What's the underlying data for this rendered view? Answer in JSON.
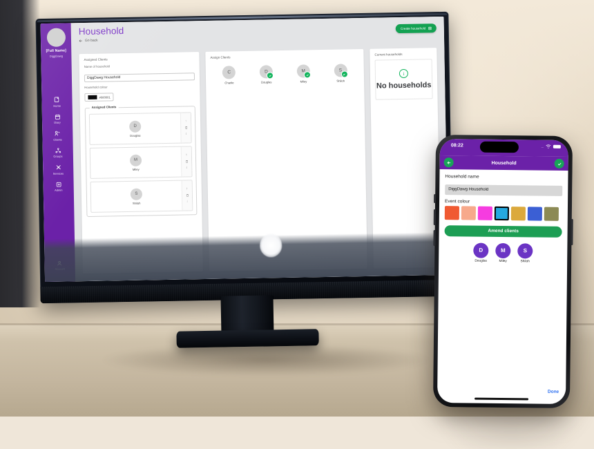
{
  "desktop": {
    "sidebar": {
      "full_name": "[Full Name]",
      "org_name": "DiggDawg",
      "items": [
        {
          "label": "Home",
          "icon": "home-icon"
        },
        {
          "label": "Diary",
          "icon": "calendar-icon"
        },
        {
          "label": "Clients",
          "icon": "clients-icon"
        },
        {
          "label": "Groups",
          "icon": "groups-icon"
        },
        {
          "label": "Services",
          "icon": "services-icon"
        },
        {
          "label": "Admin",
          "icon": "admin-icon"
        }
      ],
      "account": {
        "label": "Account",
        "icon": "account-icon"
      }
    },
    "header": {
      "title": "Household",
      "go_back": "Go back",
      "create_button": "Create household"
    },
    "panel_assigned": {
      "heading": "Assigned Clients",
      "name_label": "Name of household",
      "name_value": "DiggDawg Household",
      "colour_label": "Household colour",
      "colour_hex": "#000001",
      "fieldset_legend": "Assigned Clients",
      "clients": [
        {
          "initial": "D",
          "name": "Douglas"
        },
        {
          "initial": "M",
          "name": "Miley"
        },
        {
          "initial": "S",
          "name": "Shiloh"
        }
      ]
    },
    "panel_assign": {
      "heading": "Assign Clients",
      "clients": [
        {
          "initial": "C",
          "name": "Charlie",
          "selected": false
        },
        {
          "initial": "D",
          "name": "Douglas",
          "selected": true
        },
        {
          "initial": "M",
          "name": "Miley",
          "selected": true
        },
        {
          "initial": "S",
          "name": "Shiloh",
          "selected": true
        }
      ]
    },
    "panel_current": {
      "heading": "Current households",
      "empty_text": "No households"
    }
  },
  "phone": {
    "status": {
      "time": "08:22",
      "signal": "...."
    },
    "header": {
      "title": "Household"
    },
    "name_label": "Household name",
    "name_value": "DiggDawg Household",
    "colour_label": "Event colour",
    "colours": [
      {
        "hex": "#f05a32",
        "selected": false
      },
      {
        "hex": "#f7a98b",
        "selected": false
      },
      {
        "hex": "#f63ce0",
        "selected": false
      },
      {
        "hex": "#26a9e0",
        "selected": true
      },
      {
        "hex": "#dba93c",
        "selected": false
      },
      {
        "hex": "#3b5fd4",
        "selected": false
      },
      {
        "hex": "#8c8a55",
        "selected": false
      }
    ],
    "amend_button": "Amend clients",
    "clients": [
      {
        "initial": "D",
        "name": "Douglas"
      },
      {
        "initial": "M",
        "name": "Miley"
      },
      {
        "initial": "S",
        "name": "Shiloh"
      }
    ],
    "done_label": "Done"
  },
  "colors": {
    "brand_purple": "#6b21a8",
    "title_purple": "#7b35c7",
    "green": "#13a152",
    "phone_green": "#18a558",
    "link_blue": "#2a6ef0"
  }
}
